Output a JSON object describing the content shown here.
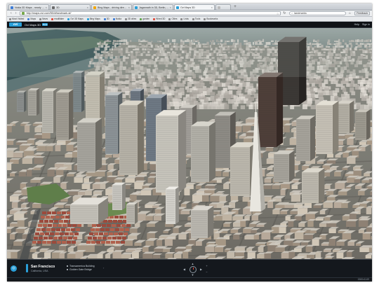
{
  "browser": {
    "tabs": [
      {
        "label": "Nokia 3D Maps - nearly indistinguishable",
        "color": "#3d7bd6",
        "active": false
      },
      {
        "label": "3D",
        "color": "#6a6a6a",
        "active": false
      },
      {
        "label": "Bing Maps - driving directions",
        "color": "#f2a600",
        "active": false
      },
      {
        "label": "Jagannath in 3D, Berlin, Deutschland",
        "color": "#2a9fd8",
        "active": false
      },
      {
        "label": "Ovi Maps 3D",
        "color": "#2a9fd8",
        "active": true
      },
      {
        "label": "",
        "color": "#bbbbbb",
        "active": false
      }
    ],
    "new_tab_label": "+",
    "back_label": "‹",
    "forward_label": "›",
    "reload_label": "↻",
    "home_label": "⌂",
    "url": "http://maps.ovi.com/3D/#/landmark-sf/",
    "search_value": "landmarks",
    "search_icon": "magnifier",
    "feedback_label": "Feedback",
    "bookmarks": [
      {
        "label": "Most Visited",
        "color": "#8a8a8a"
      },
      {
        "label": "Maps",
        "color": "#3d7bd6"
      },
      {
        "label": "News",
        "color": "#8a8a8a"
      },
      {
        "label": "readitlater",
        "color": "#e04a3a"
      },
      {
        "label": "Ovi 3D Maps",
        "color": "#2a9fd8"
      },
      {
        "label": "Bing Maps",
        "color": "#2a9fd8"
      },
      {
        "label": "3D",
        "color": "#3d7bd6"
      },
      {
        "label": "Nokia",
        "color": "#3d7bd6"
      },
      {
        "label": "3D cities",
        "color": "#8a8a8a"
      },
      {
        "label": "garden",
        "color": "#5ea44a"
      },
      {
        "label": "Wired 3D",
        "color": "#e04a3a"
      },
      {
        "label": "Cities",
        "color": "#8a8a8a"
      },
      {
        "label": "Links",
        "color": "#8a8a8a"
      },
      {
        "label": "Tools",
        "color": "#8a8a8a"
      },
      {
        "label": "Bookmarks",
        "color": "#8a8a8a"
      }
    ]
  },
  "app": {
    "logo": "ovi",
    "title": "Ovi Maps 3D",
    "beta": "Beta",
    "help": "Help",
    "sign_in": "Sign in",
    "accent": "#2a9fd8"
  },
  "location": {
    "name": "San Francisco",
    "country": "California, USA",
    "pois": [
      "Transamerica Building",
      "Golden Gate Bridge"
    ]
  },
  "controls": {
    "up": "▲",
    "down": "▼",
    "left": "◀",
    "right": "▶",
    "zoom_in": "+",
    "zoom_out": "−"
  },
  "status": {
    "coords": "1560x1149"
  }
}
